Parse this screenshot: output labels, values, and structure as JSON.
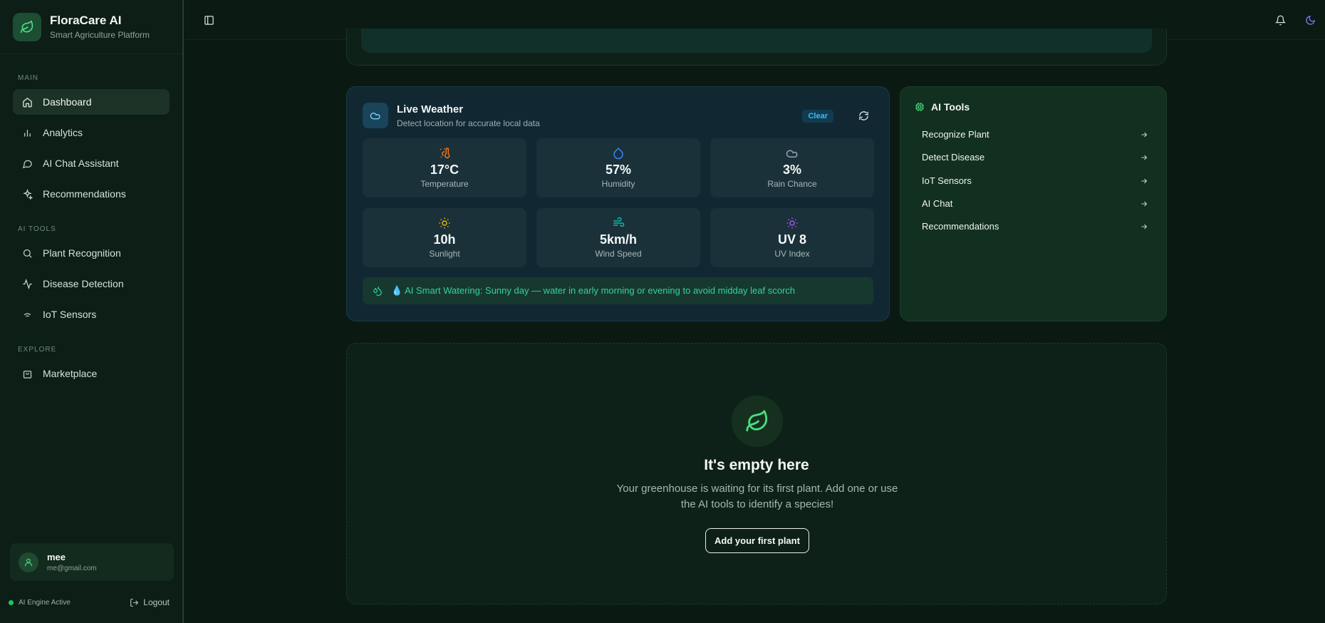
{
  "brand": {
    "title": "FloraCare AI",
    "subtitle": "Smart Agriculture Platform"
  },
  "sidebar": {
    "sections": [
      {
        "label": "MAIN",
        "items": [
          {
            "label": "Dashboard",
            "icon": "home-icon",
            "active": true
          },
          {
            "label": "Analytics",
            "icon": "bar-chart-icon"
          },
          {
            "label": "AI Chat Assistant",
            "icon": "chat-bubble-icon"
          },
          {
            "label": "Recommendations",
            "icon": "sparkles-icon"
          }
        ]
      },
      {
        "label": "AI TOOLS",
        "items": [
          {
            "label": "Plant Recognition",
            "icon": "search-icon"
          },
          {
            "label": "Disease Detection",
            "icon": "activity-icon"
          },
          {
            "label": "IoT Sensors",
            "icon": "wifi-icon"
          }
        ]
      },
      {
        "label": "EXPLORE",
        "items": [
          {
            "label": "Marketplace",
            "icon": "shopping-bag-icon"
          }
        ]
      }
    ],
    "user": {
      "name": "mee",
      "email": "me@gmail.com"
    },
    "engine_status": "AI Engine Active",
    "logout_label": "Logout"
  },
  "topbar": {
    "icons": [
      "sidebar-toggle-icon",
      "bell-icon",
      "moon-icon"
    ]
  },
  "weather": {
    "title": "Live Weather",
    "subtitle": "Detect location for accurate local data",
    "badge": "Clear",
    "stats": [
      {
        "value": "17°C",
        "label": "Temperature",
        "icon": "thermometer-sun-icon",
        "color": "#f97316"
      },
      {
        "value": "57%",
        "label": "Humidity",
        "icon": "droplet-icon",
        "color": "#3b82f6"
      },
      {
        "value": "3%",
        "label": "Rain Chance",
        "icon": "cloud-icon",
        "color": "#94a3b8"
      },
      {
        "value": "10h",
        "label": "Sunlight",
        "icon": "sun-icon",
        "color": "#eab308"
      },
      {
        "value": "5km/h",
        "label": "Wind Speed",
        "icon": "wind-icon",
        "color": "#14b8a6"
      },
      {
        "value": "UV 8",
        "label": "UV Index",
        "icon": "uv-sun-icon",
        "color": "#a855f7"
      }
    ],
    "tip": "💧 AI Smart Watering: Sunny day — water in early morning or evening to avoid midday leaf scorch"
  },
  "ai_tools": {
    "title": "AI Tools",
    "items": [
      "Recognize Plant",
      "Detect Disease",
      "IoT Sensors",
      "AI Chat",
      "Recommendations"
    ]
  },
  "empty_state": {
    "title": "It's empty here",
    "text": "Your greenhouse is waiting for its first plant. Add one or use the AI tools to identify a species!",
    "button": "Add your first plant"
  },
  "colors": {
    "accent": "#22c55e",
    "badge": "#38bdf8",
    "tip": "#34d399"
  }
}
